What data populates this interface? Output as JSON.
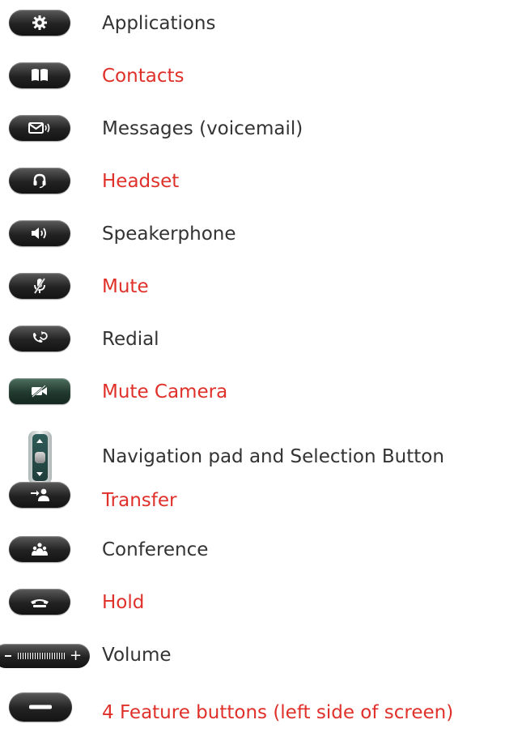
{
  "items": [
    {
      "label": "Applications",
      "icon": "gear-icon",
      "color": "#333333"
    },
    {
      "label": "Contacts",
      "icon": "book-icon",
      "color": "#e0302a"
    },
    {
      "label": "Messages (voicemail)",
      "icon": "envelope-icon",
      "color": "#333333"
    },
    {
      "label": "Headset",
      "icon": "headset-icon",
      "color": "#e0302a"
    },
    {
      "label": "Speakerphone",
      "icon": "speaker-icon",
      "color": "#333333"
    },
    {
      "label": "Mute",
      "icon": "microphone-mute-icon",
      "color": "#e0302a"
    },
    {
      "label": "Redial",
      "icon": "redial-icon",
      "color": "#333333"
    },
    {
      "label": "Mute Camera",
      "icon": "camera-mute-icon",
      "color": "#e0302a"
    },
    {
      "label": "Navigation pad and Selection Button",
      "icon": "navigation-pad-icon",
      "color": "#333333"
    },
    {
      "label": "Transfer",
      "icon": "transfer-icon",
      "color": "#e0302a"
    },
    {
      "label": "Conference",
      "icon": "conference-icon",
      "color": "#333333"
    },
    {
      "label": "Hold",
      "icon": "hold-icon",
      "color": "#e0302a"
    },
    {
      "label": "Volume",
      "icon": "volume-bar-icon",
      "color": "#333333"
    },
    {
      "label": "4 Feature buttons   (left side of screen)",
      "icon": "feature-button-icon",
      "color": "#e0302a"
    }
  ],
  "volume_symbols": {
    "minus": "-",
    "plus": "+"
  }
}
